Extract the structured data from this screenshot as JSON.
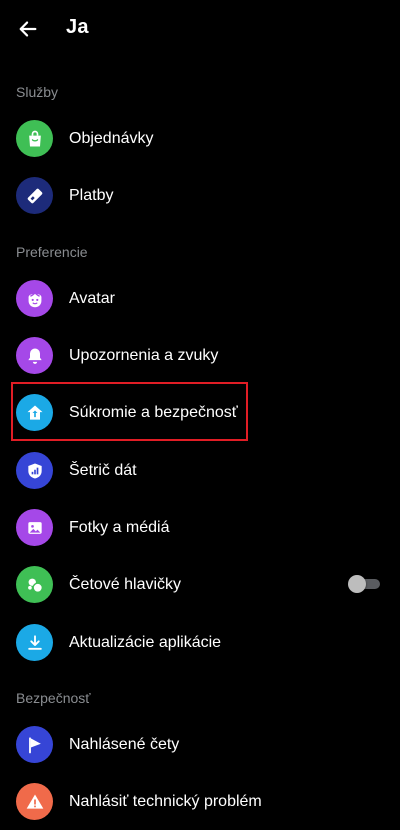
{
  "header": {
    "title": "Ja",
    "back_icon": "arrow-left-icon"
  },
  "sections": {
    "services": "Služby",
    "preferences": "Preferencie",
    "safety": "Bezpečnosť"
  },
  "items": {
    "orders": {
      "label": "Objednávky",
      "icon": "shopping-bag-icon",
      "color": "#3fbf55"
    },
    "payments": {
      "label": "Platby",
      "icon": "payment-card-icon",
      "color": "#1d2b7a"
    },
    "avatar": {
      "label": "Avatar",
      "icon": "avatar-face-icon",
      "color": "#a548e8"
    },
    "notifications": {
      "label": "Upozornenia a zvuky",
      "icon": "bell-icon",
      "color": "#a548e8"
    },
    "privacy": {
      "label": "Súkromie a bezpečnosť",
      "icon": "house-shield-icon",
      "color": "#1ba9e6"
    },
    "data_saver": {
      "label": "Šetrič dát",
      "icon": "signal-shield-icon",
      "color": "#3645d6"
    },
    "photos": {
      "label": "Fotky a médiá",
      "icon": "photo-icon",
      "color": "#a548e8"
    },
    "chat_heads": {
      "label": "Četové hlavičky",
      "icon": "chat-bubbles-icon",
      "color": "#3fbf55",
      "toggle_on": false
    },
    "app_updates": {
      "label": "Aktualizácie aplikácie",
      "icon": "download-icon",
      "color": "#1ba9e6"
    },
    "reported_chats": {
      "label": "Nahlásené čety",
      "icon": "flag-icon",
      "color": "#3645d6"
    },
    "report_problem": {
      "label": "Nahlásiť technický problém",
      "icon": "warning-icon",
      "color": "#f06a4a"
    }
  }
}
